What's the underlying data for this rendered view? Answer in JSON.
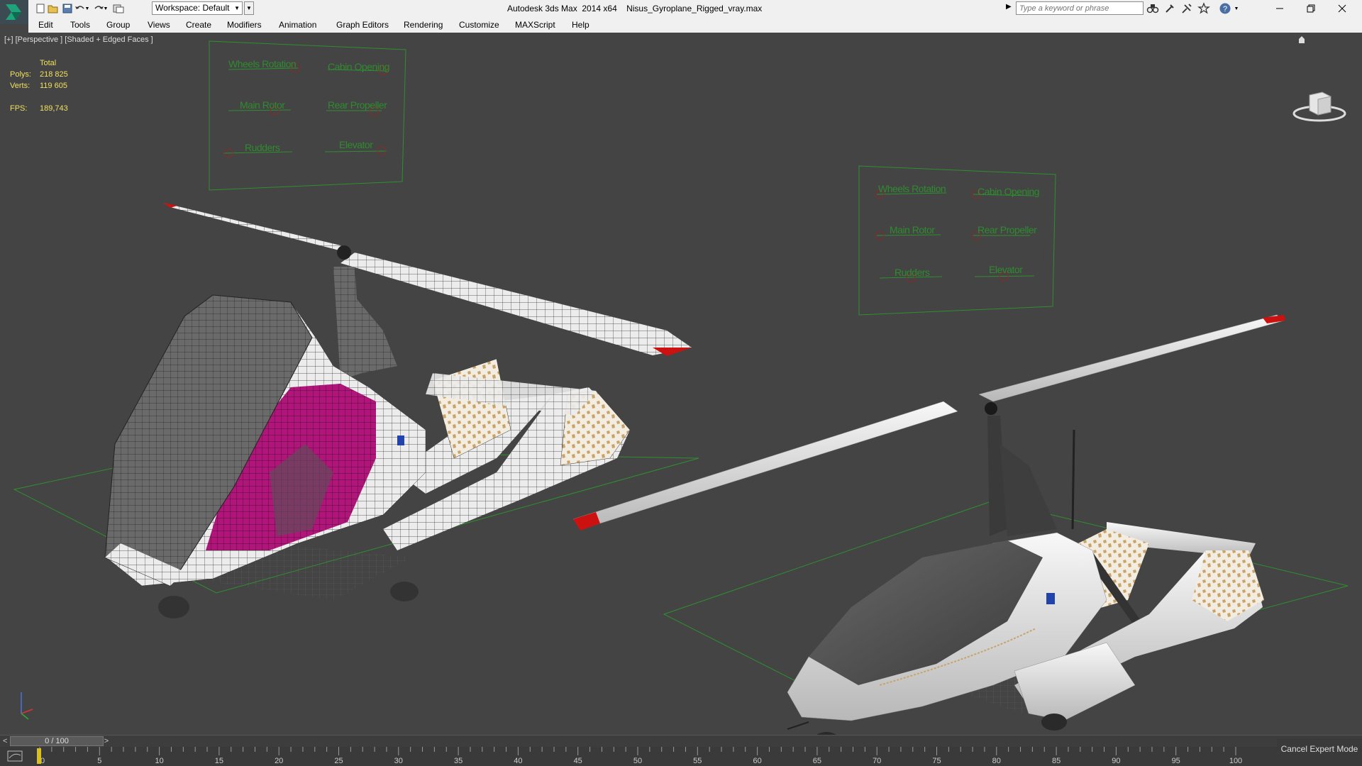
{
  "titlebar": {
    "workspace_label": "Workspace: Default",
    "app_title": "Autodesk 3ds Max  2014 x64    Nisus_Gyroplane_Rigged_vray.max",
    "search_placeholder": "Type a keyword or phrase",
    "window_controls": [
      "minimize-icon",
      "restore-icon",
      "close-icon"
    ]
  },
  "menubar": {
    "items": [
      "Edit",
      "Tools",
      "Group",
      "Views",
      "Create",
      "Modifiers",
      "Animation",
      "Graph Editors",
      "Rendering",
      "Customize",
      "MAXScript",
      "Help"
    ]
  },
  "viewport": {
    "label": "[+] [Perspective ] [Shaded + Edged Faces ]",
    "stats": {
      "header": "Total",
      "polys_label": "Polys:",
      "polys_value": "218 825",
      "verts_label": "Verts:",
      "verts_value": "119 605",
      "fps_label": "FPS:",
      "fps_value": "189,743"
    },
    "control_panels": [
      {
        "labels": [
          "Wheels Rotation",
          "Cabin Opening",
          "Main Rotor",
          "Rear Propeller",
          "Rudders",
          "Elevator"
        ]
      },
      {
        "labels": [
          "Wheels Rotation",
          "Cabin Opening",
          "Main Rotor",
          "Rear Propeller",
          "Rudders",
          "Elevator"
        ]
      }
    ],
    "colors": {
      "background": "#444444",
      "grid": "#2f8f2f",
      "wire": "#222222",
      "cabin_interior": "#b0157a",
      "rotor_tip": "#cc1111"
    }
  },
  "timeline": {
    "frame_readout": "0 / 100",
    "prev_label": "<",
    "next_label": ">",
    "ticks": [
      "0",
      "5",
      "10",
      "15",
      "20",
      "25",
      "30",
      "35",
      "40",
      "45",
      "50",
      "55",
      "60",
      "65",
      "70",
      "75",
      "80",
      "85",
      "90",
      "95",
      "100"
    ],
    "cancel_expert_label": "Cancel Expert Mode"
  }
}
